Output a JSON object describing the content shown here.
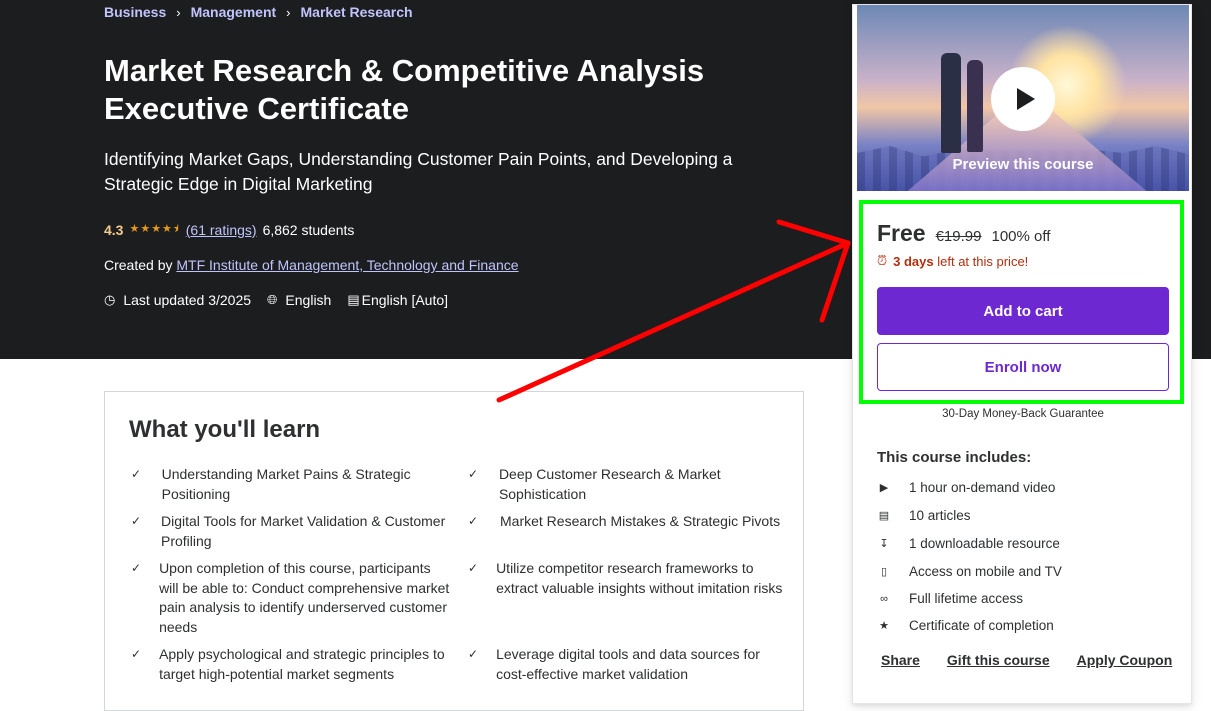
{
  "breadcrumb": [
    "Business",
    "Management",
    "Market Research"
  ],
  "course": {
    "title": "Market Research & Competitive Analysis Executive Certificate",
    "subtitle": "Identifying Market Gaps, Understanding Customer Pain Points, and Developing a Strategic Edge in Digital Marketing",
    "rating": "4.3",
    "rating_count": "(61 ratings)",
    "students": "6,862 students",
    "created_by_label": "Created by",
    "instructor": "MTF Institute of Management, Technology and Finance",
    "last_updated": "Last updated 3/2025",
    "language": "English",
    "captions": "English [Auto]"
  },
  "learn": {
    "title": "What you'll learn",
    "items": [
      "Understanding Market Pains & Strategic Positioning",
      "Deep Customer Research & Market Sophistication",
      "Digital Tools for Market Validation & Customer Profiling",
      "Market Research Mistakes & Strategic Pivots",
      "Upon completion of this course, participants will be able to: Conduct comprehensive market pain analysis to identify underserved customer needs",
      "Utilize competitor research frameworks to extract valuable insights without imitation risks",
      "Apply psychological and strategic principles to target high-potential market segments",
      "Leverage digital tools and data sources for cost-effective market validation"
    ]
  },
  "card": {
    "preview_label": "Preview this course",
    "price": "Free",
    "old_price": "€19.99",
    "discount": "100% off",
    "timer_bold": "3 days",
    "timer_rest": "left at this price!",
    "add_to_cart": "Add to cart",
    "enroll_now": "Enroll now",
    "guarantee": "30-Day Money-Back Guarantee",
    "includes_title": "This course includes:",
    "includes": [
      {
        "icon": "video-icon",
        "text": "1 hour on-demand video"
      },
      {
        "icon": "article-icon",
        "text": "10 articles"
      },
      {
        "icon": "download-icon",
        "text": "1 downloadable resource"
      },
      {
        "icon": "mobile-icon",
        "text": "Access on mobile and TV"
      },
      {
        "icon": "infinity-icon",
        "text": "Full lifetime access"
      },
      {
        "icon": "trophy-icon",
        "text": "Certificate of completion"
      }
    ],
    "actions": [
      "Share",
      "Gift this course",
      "Apply Coupon"
    ]
  },
  "colors": {
    "hero_bg": "#1c1d1f",
    "accent_purple": "#6d28d2",
    "link_lilac": "#c0c4fc",
    "star": "#e59819",
    "highlight_green": "#00ff00",
    "annotation_red": "#ff0000"
  }
}
